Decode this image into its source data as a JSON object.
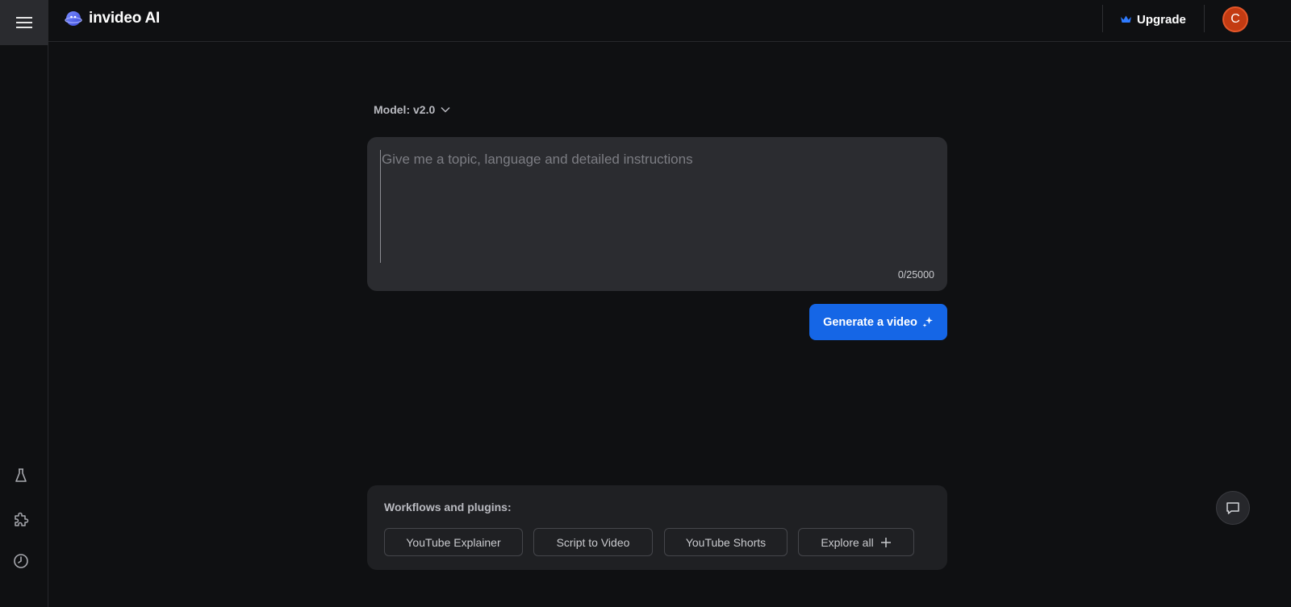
{
  "header": {
    "brand_name": "invideo AI",
    "upgrade_label": "Upgrade",
    "avatar_initial": "C"
  },
  "composer": {
    "model_label": "Model: v2.0",
    "prompt_placeholder": "Give me a topic, language and detailed instructions",
    "prompt_value": "",
    "char_count": "0/25000",
    "generate_label": "Generate a video"
  },
  "workflows": {
    "title": "Workflows and plugins:",
    "items": [
      {
        "label": "YouTube Explainer"
      },
      {
        "label": "Script to Video"
      },
      {
        "label": "YouTube Shorts"
      },
      {
        "label": "Explore all"
      }
    ]
  },
  "sidebar": {
    "icons": [
      "menu-icon",
      "flask-icon",
      "puzzle-icon",
      "clock-icon"
    ]
  },
  "colors": {
    "background": "#0f1012",
    "accent": "#1566e6",
    "panel": "#2b2c30",
    "avatar": "#c33b12"
  }
}
